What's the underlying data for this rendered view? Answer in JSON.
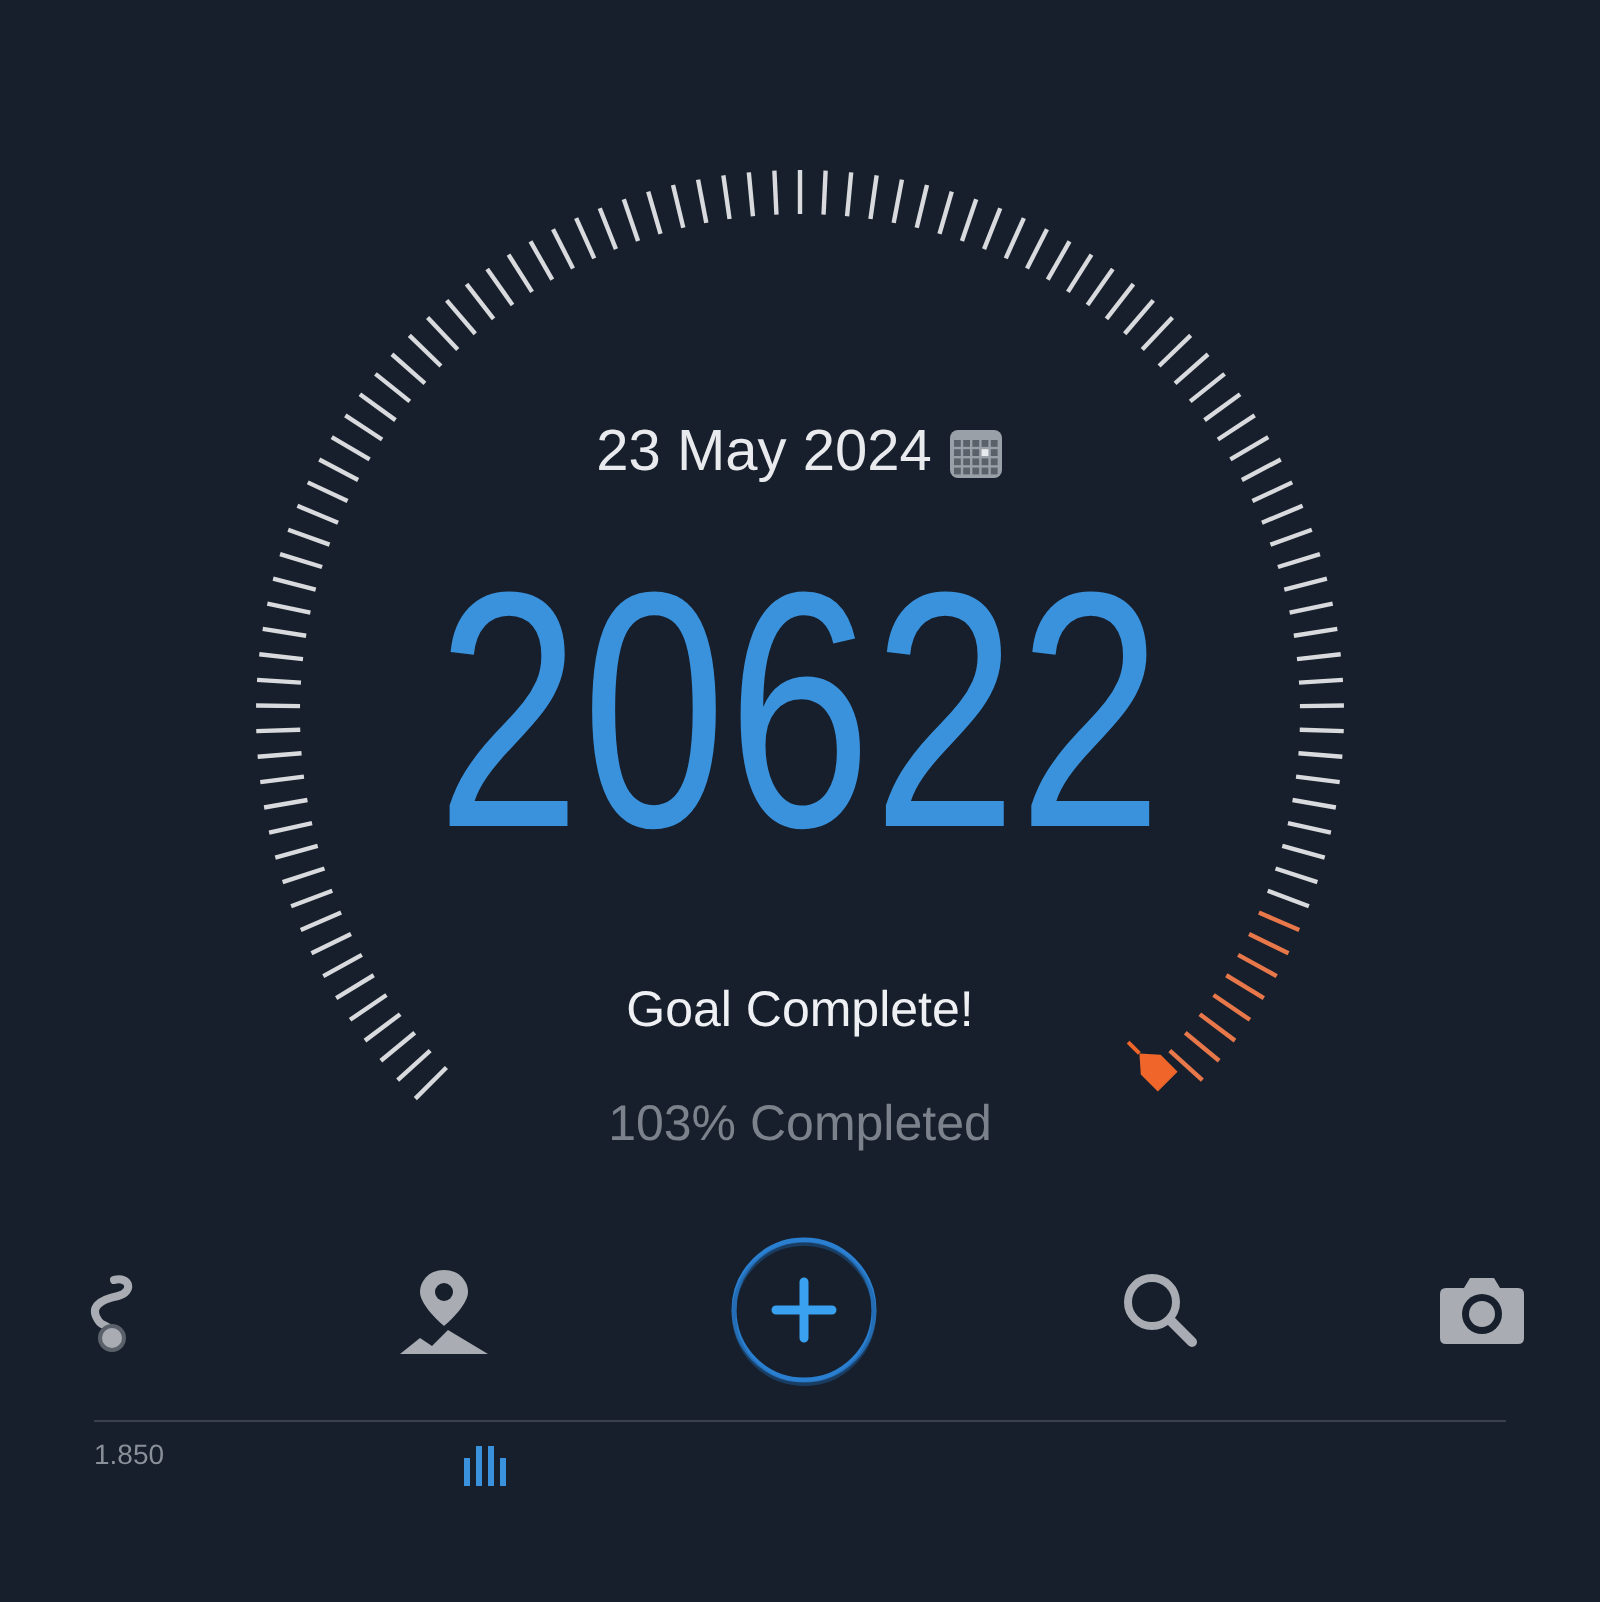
{
  "date": "23 May 2024",
  "steps": "20622",
  "status": "Goal Complete!",
  "progress_text": "103% Completed",
  "toolbar": [
    {
      "kind": "route"
    },
    {
      "kind": "map-pin"
    },
    {
      "kind": "add"
    },
    {
      "kind": "search"
    },
    {
      "kind": "camera"
    }
  ],
  "chart": {
    "y_label": "1.850"
  }
}
